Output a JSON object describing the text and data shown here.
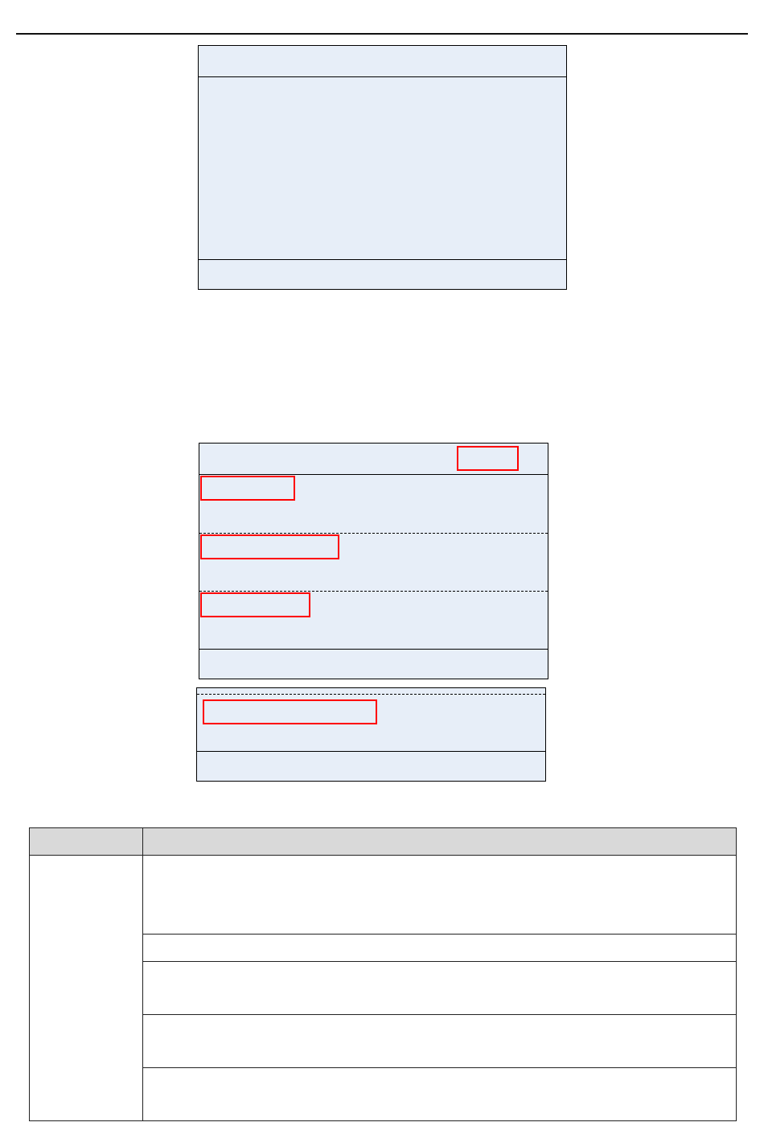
{
  "screens": [
    {
      "sections": [
        {
          "kind": "header",
          "highlighted": false
        },
        {
          "kind": "body",
          "highlighted": false
        },
        {
          "kind": "footer",
          "highlighted": false
        }
      ]
    },
    {
      "sections": [
        {
          "kind": "header",
          "highlighted": true
        },
        {
          "kind": "entry",
          "highlighted": true
        },
        {
          "kind": "entry",
          "highlighted": true
        },
        {
          "kind": "entry",
          "highlighted": true
        },
        {
          "kind": "footer",
          "highlighted": false
        }
      ]
    },
    {
      "sections": [
        {
          "kind": "entry",
          "highlighted": true
        },
        {
          "kind": "footer",
          "highlighted": false
        }
      ]
    }
  ],
  "table": {
    "header": {
      "shaded": true
    },
    "groups": [
      {
        "rows": [
          {
            "kind": "tall"
          },
          {
            "kind": "short"
          },
          {
            "kind": "medium"
          },
          {
            "kind": "medium"
          },
          {
            "kind": "medium"
          }
        ]
      }
    ]
  }
}
